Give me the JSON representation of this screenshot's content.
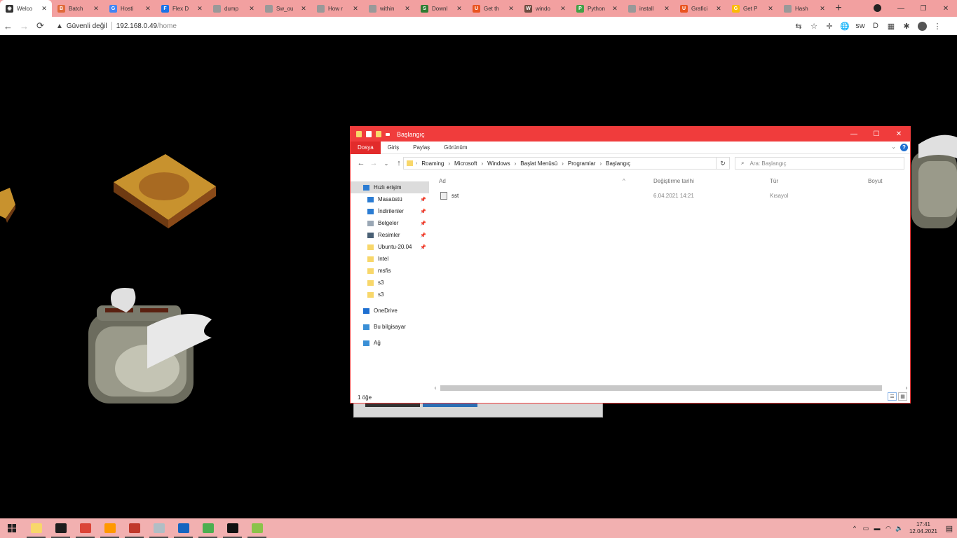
{
  "browser": {
    "tabs": [
      {
        "label": "Welco",
        "color": "#333333",
        "glyph": "◉",
        "active": true
      },
      {
        "label": "Batch",
        "color": "#e06a3a",
        "glyph": "B",
        "active": false
      },
      {
        "label": "Hosti",
        "color": "#4285f4",
        "glyph": "G",
        "active": false
      },
      {
        "label": "Flex D",
        "color": "#1a73e8",
        "glyph": "F",
        "active": false
      },
      {
        "label": "dump",
        "color": "#999999",
        "glyph": "",
        "active": false
      },
      {
        "label": "Sw_ou",
        "color": "#999999",
        "glyph": "",
        "active": false
      },
      {
        "label": "How r",
        "color": "#999999",
        "glyph": "",
        "active": false
      },
      {
        "label": "within",
        "color": "#999999",
        "glyph": "",
        "active": false
      },
      {
        "label": "Downl",
        "color": "#2e7d32",
        "glyph": "S",
        "active": false
      },
      {
        "label": "Get th",
        "color": "#e95420",
        "glyph": "U",
        "active": false
      },
      {
        "label": "windo",
        "color": "#6d4c41",
        "glyph": "W",
        "active": false
      },
      {
        "label": "Python",
        "color": "#43a047",
        "glyph": "P",
        "active": false
      },
      {
        "label": "install",
        "color": "#999999",
        "glyph": "",
        "active": false
      },
      {
        "label": "Grafici",
        "color": "#e95420",
        "glyph": "U",
        "active": false
      },
      {
        "label": "Get P",
        "color": "#fbbc04",
        "glyph": "G",
        "active": false
      },
      {
        "label": "Hash",
        "color": "#999999",
        "glyph": "",
        "active": false
      }
    ],
    "new_tab": "+",
    "window_controls": {
      "minimize": "—",
      "maximize": "❐",
      "close": "✕"
    },
    "nav": {
      "back": "←",
      "forward": "→",
      "reload": "⟳"
    },
    "address": {
      "security_icon": "▲",
      "security_text": "Güvenli değil",
      "host": "192.168.0.49",
      "path": "/home"
    },
    "toolbar_icons": [
      "⇆",
      "☆",
      "✛",
      "🌐",
      "sw",
      "D",
      "▦",
      "✱"
    ]
  },
  "explorer": {
    "title": "Başlangıç",
    "window_controls": {
      "minimize": "—",
      "maximize": "☐",
      "close": "✕"
    },
    "ribbon_tabs": [
      "Dosya",
      "Giriş",
      "Paylaş",
      "Görünüm"
    ],
    "help": "?",
    "breadcrumb": [
      "Roaming",
      "Microsoft",
      "Windows",
      "Başlat Menüsü",
      "Programlar",
      "Başlangıç"
    ],
    "search_placeholder": "Ara: Başlangıç",
    "nav_pane": [
      {
        "label": "Hızlı erişim",
        "icon": "star-icon",
        "color": "#2b7cd3",
        "pinned": false,
        "selected": true,
        "group": "quick"
      },
      {
        "label": "Masaüstü",
        "icon": "desktop-icon",
        "color": "#2b7cd3",
        "pinned": true,
        "selected": false,
        "group": "quick"
      },
      {
        "label": "İndirilenler",
        "icon": "download-icon",
        "color": "#2b7cd3",
        "pinned": true,
        "selected": false,
        "group": "quick"
      },
      {
        "label": "Belgeler",
        "icon": "documents-icon",
        "color": "#9aa7b5",
        "pinned": true,
        "selected": false,
        "group": "quick"
      },
      {
        "label": "Resimler",
        "icon": "pictures-icon",
        "color": "#4a6075",
        "pinned": true,
        "selected": false,
        "group": "quick"
      },
      {
        "label": "Ubuntu-20.04",
        "icon": "linux-icon",
        "color": "#f8d76a",
        "pinned": true,
        "selected": false,
        "group": "quick"
      },
      {
        "label": "Intel",
        "icon": "folder-icon",
        "color": "#f8d76a",
        "pinned": false,
        "selected": false,
        "group": "quick"
      },
      {
        "label": "msfis",
        "icon": "folder-icon",
        "color": "#f8d76a",
        "pinned": false,
        "selected": false,
        "group": "quick"
      },
      {
        "label": "s3",
        "icon": "folder-icon",
        "color": "#f8d76a",
        "pinned": false,
        "selected": false,
        "group": "quick"
      },
      {
        "label": "s3",
        "icon": "folder-icon",
        "color": "#f8d76a",
        "pinned": false,
        "selected": false,
        "group": "quick"
      },
      {
        "label": "OneDrive",
        "icon": "cloud-icon",
        "color": "#1e6fd0",
        "pinned": false,
        "selected": false,
        "group": "onedrive"
      },
      {
        "label": "Bu bilgisayar",
        "icon": "computer-icon",
        "color": "#3a8fd6",
        "pinned": false,
        "selected": false,
        "group": "pc"
      },
      {
        "label": "Ağ",
        "icon": "network-icon",
        "color": "#3a8fd6",
        "pinned": false,
        "selected": false,
        "group": "net"
      }
    ],
    "columns": {
      "name": "Ad",
      "modified": "Değiştirme tarihi",
      "type": "Tür",
      "size": "Boyut"
    },
    "files": [
      {
        "name": "sst",
        "modified": "6.04.2021 14:21",
        "type": "Kısayol",
        "size": ""
      }
    ],
    "status": "1 öğe"
  },
  "taskbar": {
    "apps": [
      {
        "name": "file-explorer",
        "color": "#f8d76a",
        "running": true
      },
      {
        "name": "terminal",
        "color": "#1e1e1e",
        "running": true
      },
      {
        "name": "chrome",
        "color": "#db4437",
        "running": true
      },
      {
        "name": "sublime",
        "color": "#ff9800",
        "running": true
      },
      {
        "name": "mail-app",
        "color": "#c0392b",
        "running": true
      },
      {
        "name": "explorer-window",
        "color": "#b0bec5",
        "running": true
      },
      {
        "name": "powershell",
        "color": "#1565c0",
        "running": true
      },
      {
        "name": "xbox-app",
        "color": "#4caf50",
        "running": true
      },
      {
        "name": "cmd",
        "color": "#111111",
        "running": true
      },
      {
        "name": "notepad-plus",
        "color": "#8bc34a",
        "running": true
      }
    ],
    "tray": {
      "time": "17:41",
      "date": "12.04.2021"
    }
  }
}
